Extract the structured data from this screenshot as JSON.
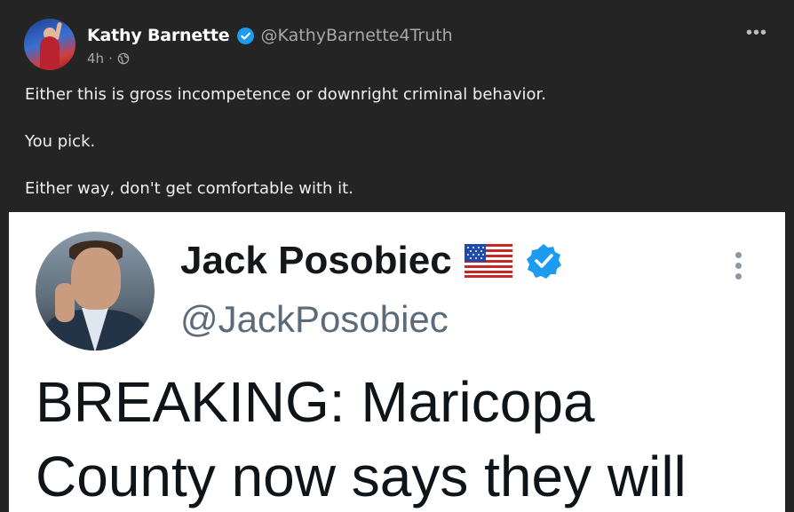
{
  "post": {
    "author_name": "Kathy Barnette",
    "handle": "@KathyBarnette4Truth",
    "time": "4h",
    "separator": "·",
    "more_label": "•••",
    "body": [
      "Either this is gross incompetence or downright criminal behavior.",
      "You pick.",
      "Either way, don't get comfortable with it."
    ]
  },
  "embed": {
    "author_name": "Jack Posobiec",
    "handle": "@JackPosobiec",
    "text_lines": [
      "BREAKING: Maricopa",
      "County now says they will"
    ]
  },
  "icons": {
    "verified": "verified-badge-icon",
    "globe": "globe-icon",
    "more": "more-options-icon",
    "flag": "us-flag-icon"
  },
  "colors": {
    "background": "#242424",
    "verified": "#1d9bf0",
    "embed_bg": "#ffffff"
  }
}
